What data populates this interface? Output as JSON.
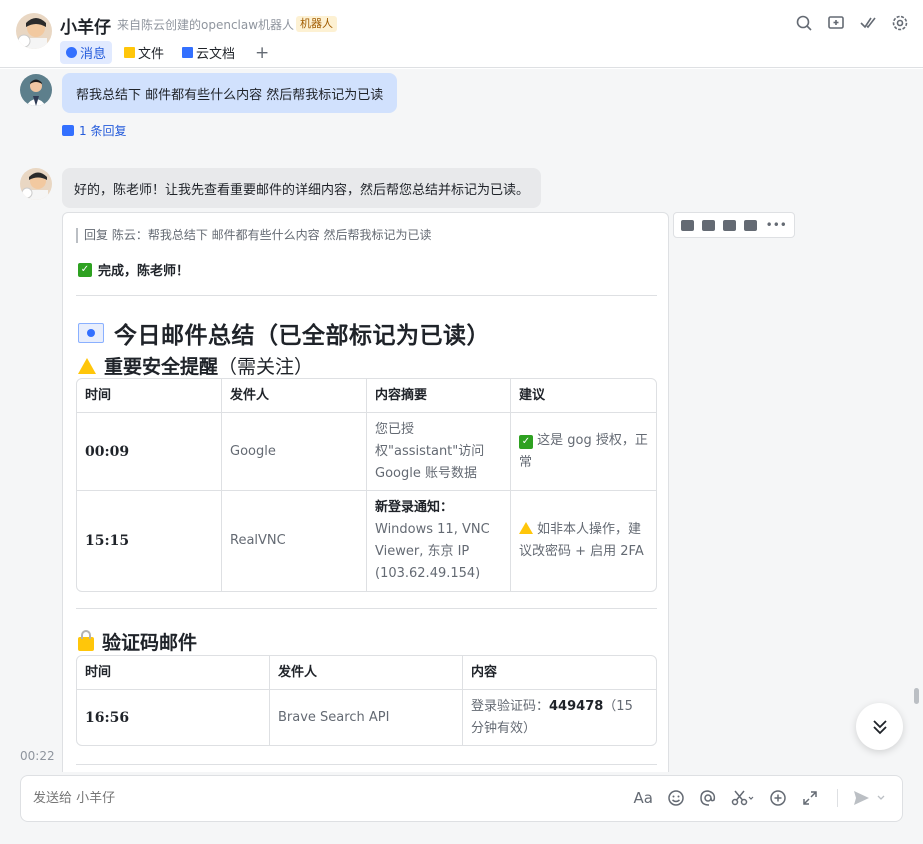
{
  "header": {
    "title": "小羊仔",
    "subtitle": "来自陈云创建的openclaw机器人",
    "badge": "机器人",
    "tabs": [
      {
        "label": "消息",
        "icon": "chat-icon",
        "active": true
      },
      {
        "label": "文件",
        "icon": "folder-icon",
        "active": false
      },
      {
        "label": "云文档",
        "icon": "doc-icon",
        "active": false
      }
    ],
    "add_tab": "+",
    "actions": [
      "search-icon",
      "add-window-icon",
      "check-all-icon",
      "settings-icon"
    ]
  },
  "messages": {
    "user_message": "帮我总结下 邮件都有些什么内容 然后帮我标记为已读",
    "reply_count": "1 条回复",
    "bot_message": "好的，陈老师！让我先查看重要邮件的详细内容，然后帮您总结并标记为已读。",
    "card": {
      "quote": "回复 陈云：帮我总结下 邮件都有些什么内容 然后帮我标记为已读",
      "done": "完成，陈老师！",
      "title": "今日邮件总结（已全部标记为已读）",
      "section1": {
        "title": "重要安全提醒",
        "note": "（需关注）",
        "headers": [
          "时间",
          "发件人",
          "内容摘要",
          "建议"
        ],
        "rows": [
          {
            "time": "00:09",
            "sender": "Google",
            "summary": "您已授权\"assistant\"访问 Google 账号数据",
            "suggestion": "这是 gog 授权，正常"
          },
          {
            "time": "15:15",
            "sender": "RealVNC",
            "summary_bold": "新登录通知：",
            "summary": "Windows 11, VNC Viewer, 东京 IP (103.62.49.154)",
            "suggestion": "如非本人操作，建议改密码 + 启用 2FA"
          }
        ]
      },
      "section2": {
        "title": "验证码邮件",
        "headers": [
          "时间",
          "发件人",
          "内容"
        ],
        "rows": [
          {
            "time": "16:56",
            "sender": "Brave Search API",
            "content_prefix": "登录验证码：",
            "code": "449478",
            "content_suffix": "（15 分钟有效）"
          }
        ]
      }
    },
    "timestamp": "00:22"
  },
  "composer": {
    "placeholder": "发送给 小羊仔"
  }
}
